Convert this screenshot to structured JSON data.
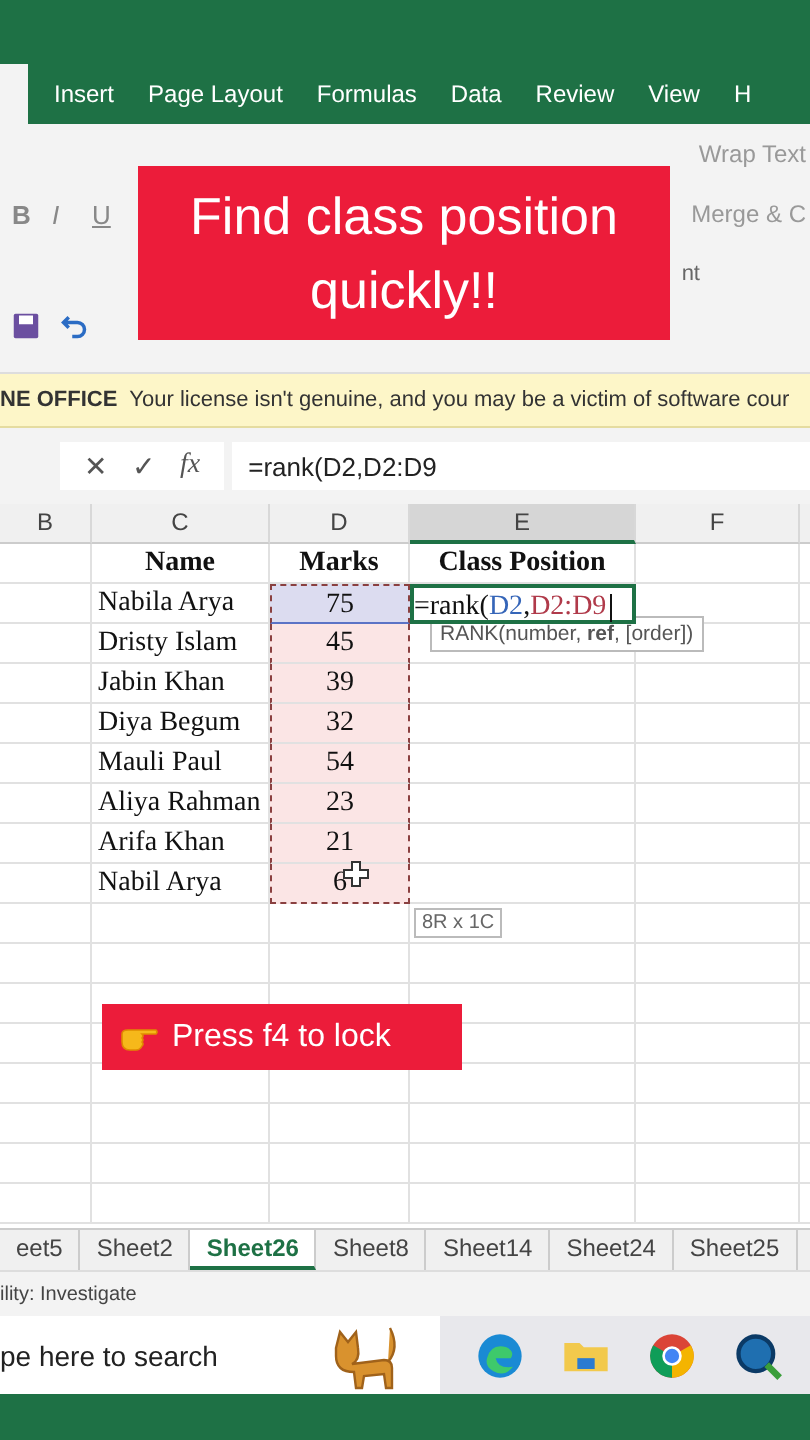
{
  "ribbon_tabs": [
    {
      "label": "Insert",
      "selected": false
    },
    {
      "label": "Page Layout",
      "selected": false
    },
    {
      "label": "Formulas",
      "selected": false
    },
    {
      "label": "Data",
      "selected": false
    },
    {
      "label": "Review",
      "selected": false
    },
    {
      "label": "View",
      "selected": false
    },
    {
      "label": "H",
      "selected": false
    }
  ],
  "ribbon": {
    "format_buttons": [
      "B",
      "I",
      "U"
    ],
    "wrap_text": "Wrap Text",
    "merge": "Merge & C",
    "group_label": "nt"
  },
  "banner": {
    "text": "Find class position quickly!!"
  },
  "license_bar": {
    "title": "NE OFFICE",
    "message": "Your license isn't genuine, and you may be a victim of software cour"
  },
  "formula_bar": {
    "cancel": "✕",
    "enter": "✓",
    "fx": "fx",
    "formula": "=rank(D2,D2:D9"
  },
  "columns": [
    {
      "label": "B",
      "selected": false
    },
    {
      "label": "C",
      "selected": false
    },
    {
      "label": "D",
      "selected": false
    },
    {
      "label": "E",
      "selected": true
    },
    {
      "label": "F",
      "selected": false
    }
  ],
  "table": {
    "headers": [
      "Name",
      "Marks",
      "Class Position"
    ],
    "rows": [
      {
        "name": "Nabila Arya",
        "marks": "75",
        "selected": true
      },
      {
        "name": "Dristy Islam",
        "marks": "45",
        "selected": false
      },
      {
        "name": "Jabin Khan",
        "marks": "39",
        "selected": false
      },
      {
        "name": "Diya Begum",
        "marks": "32",
        "selected": false
      },
      {
        "name": "Mauli Paul",
        "marks": "54",
        "selected": false
      },
      {
        "name": "Aliya Rahman",
        "marks": "23",
        "selected": false
      },
      {
        "name": "Arifa Khan",
        "marks": "21",
        "selected": false
      },
      {
        "name": "Nabil Arya",
        "marks": "6",
        "selected": false
      }
    ]
  },
  "editing_cell": {
    "parts": [
      {
        "text": "=rank(",
        "kind": "plain"
      },
      {
        "text": "D2",
        "kind": "ref_blue"
      },
      {
        "text": ",",
        "kind": "plain"
      },
      {
        "text": "D2:D9",
        "kind": "ref_red"
      }
    ]
  },
  "function_tooltip": "RANK(number, **ref**, [order])",
  "range_tooltip": "8R x 1C",
  "hint": {
    "text": "Press f4 to lock"
  },
  "sheet_tabs": [
    {
      "label": "eet5",
      "selected": false
    },
    {
      "label": "Sheet2",
      "selected": false
    },
    {
      "label": "Sheet26",
      "selected": true
    },
    {
      "label": "Sheet8",
      "selected": false
    },
    {
      "label": "Sheet14",
      "selected": false
    },
    {
      "label": "Sheet24",
      "selected": false
    },
    {
      "label": "Sheet25",
      "selected": false
    }
  ],
  "status_bar": "ility: Investigate",
  "taskbar": {
    "search_placeholder": "pe here to search"
  }
}
